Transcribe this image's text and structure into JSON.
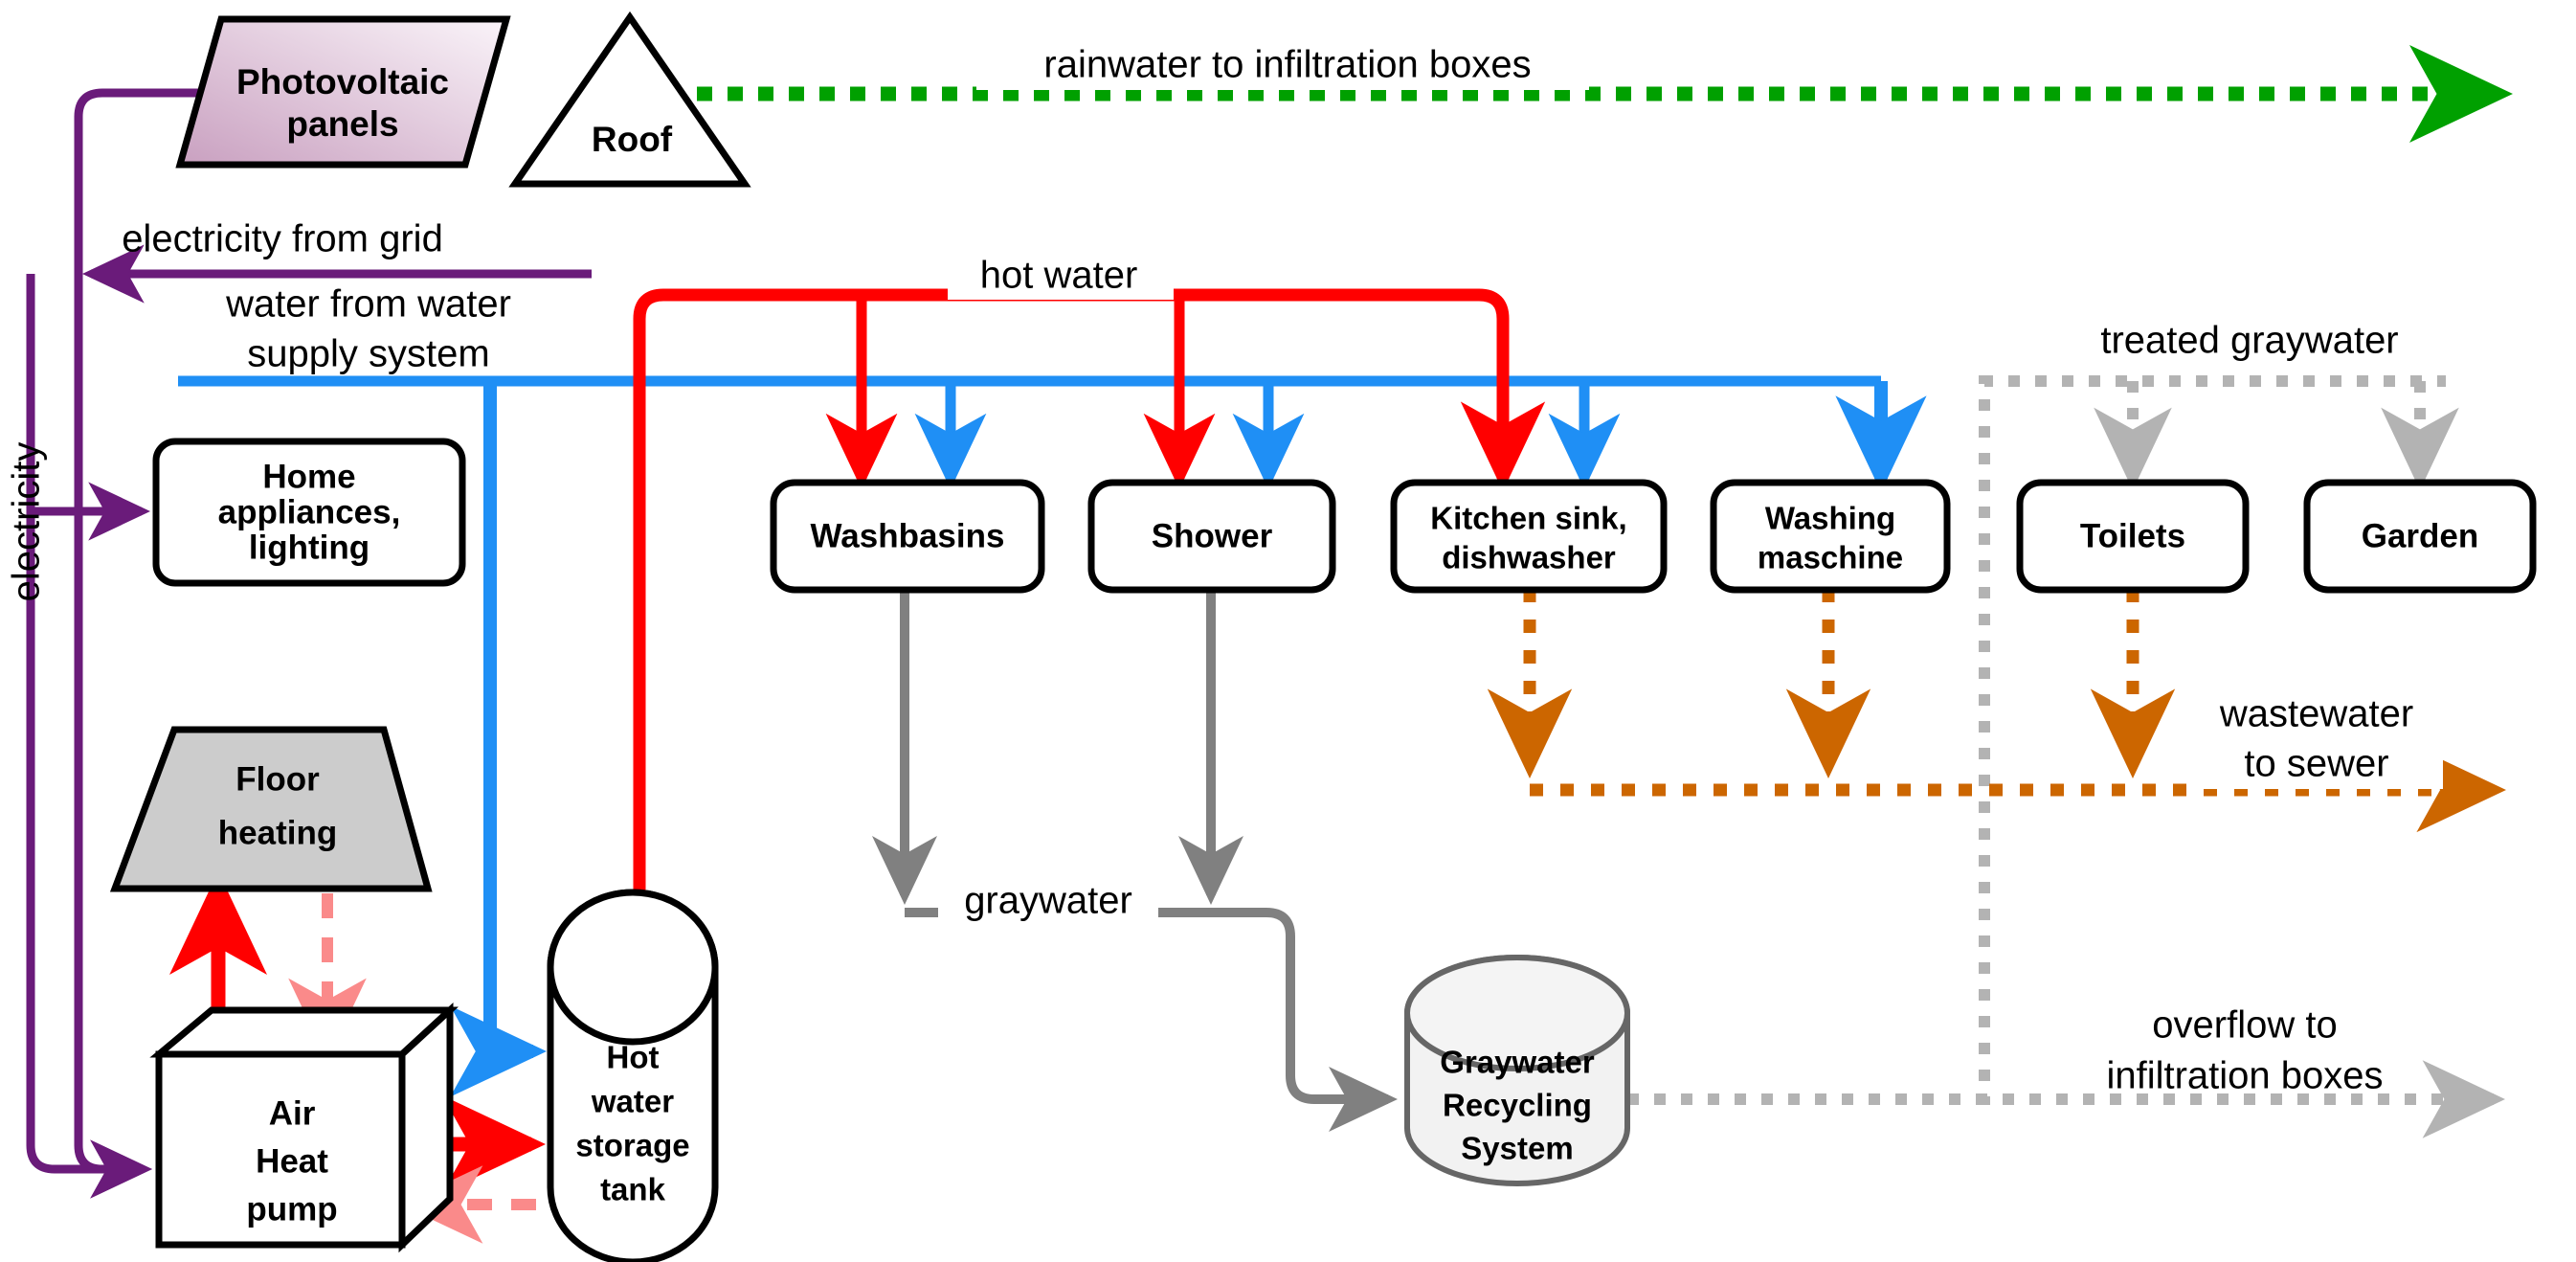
{
  "diagram": {
    "title": "Household water and energy flow diagram",
    "background": "#ffffff"
  },
  "colors": {
    "electricity": "#6a1b7a",
    "hot_water": "#ff0000",
    "hot_water_soft": "#fa8a8a",
    "cold_water": "#1f8ff5",
    "graywater": "#808080",
    "treated_graywater": "#b3b3b3",
    "wastewater": "#cc6600",
    "rainwater": "#00a000",
    "node_fill": "#ffffff",
    "pv_fill_a": "#c9a0c0",
    "pv_fill_b": "#f6eef5",
    "floor_fill": "#cccccc",
    "cylinder_fill": "#f2f2f2",
    "stroke": "#000000"
  },
  "nodes": {
    "photovoltaic": {
      "label_line1": "Photovoltaic",
      "label_line2": "panels",
      "shape": "parallelogram"
    },
    "roof": {
      "label": "Roof",
      "shape": "triangle"
    },
    "home_appliances": {
      "label_line1": "Home",
      "label_line2": "appliances,",
      "label_line3": "lighting",
      "shape": "rounded-rect"
    },
    "floor_heating": {
      "label_line1": "Floor",
      "label_line2": "heating",
      "shape": "trapezoid"
    },
    "heat_pump": {
      "label_line1": "Air",
      "label_line2": "Heat",
      "label_line3": "pump",
      "shape": "cube"
    },
    "hot_water_tank": {
      "label_line1": "Hot",
      "label_line2": "water",
      "label_line3": "storage",
      "label_line4": "tank",
      "shape": "cylinder"
    },
    "washbasins": {
      "label": "Washbasins",
      "shape": "rounded-rect"
    },
    "shower": {
      "label": "Shower",
      "shape": "rounded-rect"
    },
    "kitchen_sink": {
      "label_line1": "Kitchen sink,",
      "label_line2": "dishwasher",
      "shape": "rounded-rect"
    },
    "washing_machine": {
      "label_line1": "Washing",
      "label_line2": "maschine",
      "shape": "rounded-rect"
    },
    "toilets": {
      "label": "Toilets",
      "shape": "rounded-rect"
    },
    "garden": {
      "label": "Garden",
      "shape": "rounded-rect"
    },
    "graywater_recycling": {
      "label_line1": "Graywater",
      "label_line2": "Recycling",
      "label_line3": "System",
      "shape": "cylinder"
    }
  },
  "flow_labels": {
    "rainwater": "rainwater to infiltration boxes",
    "electricity_from_grid": "electricity from grid",
    "water_supply_line1": "water from water",
    "water_supply_line2": "supply system",
    "hot_water": "hot water",
    "electricity_vertical": "electricity",
    "treated_graywater": "treated graywater",
    "wastewater_line1": "wastewater",
    "wastewater_line2": "to sewer",
    "graywater": "graywater",
    "overflow_line1": "overflow to",
    "overflow_line2": "infiltration boxes"
  }
}
